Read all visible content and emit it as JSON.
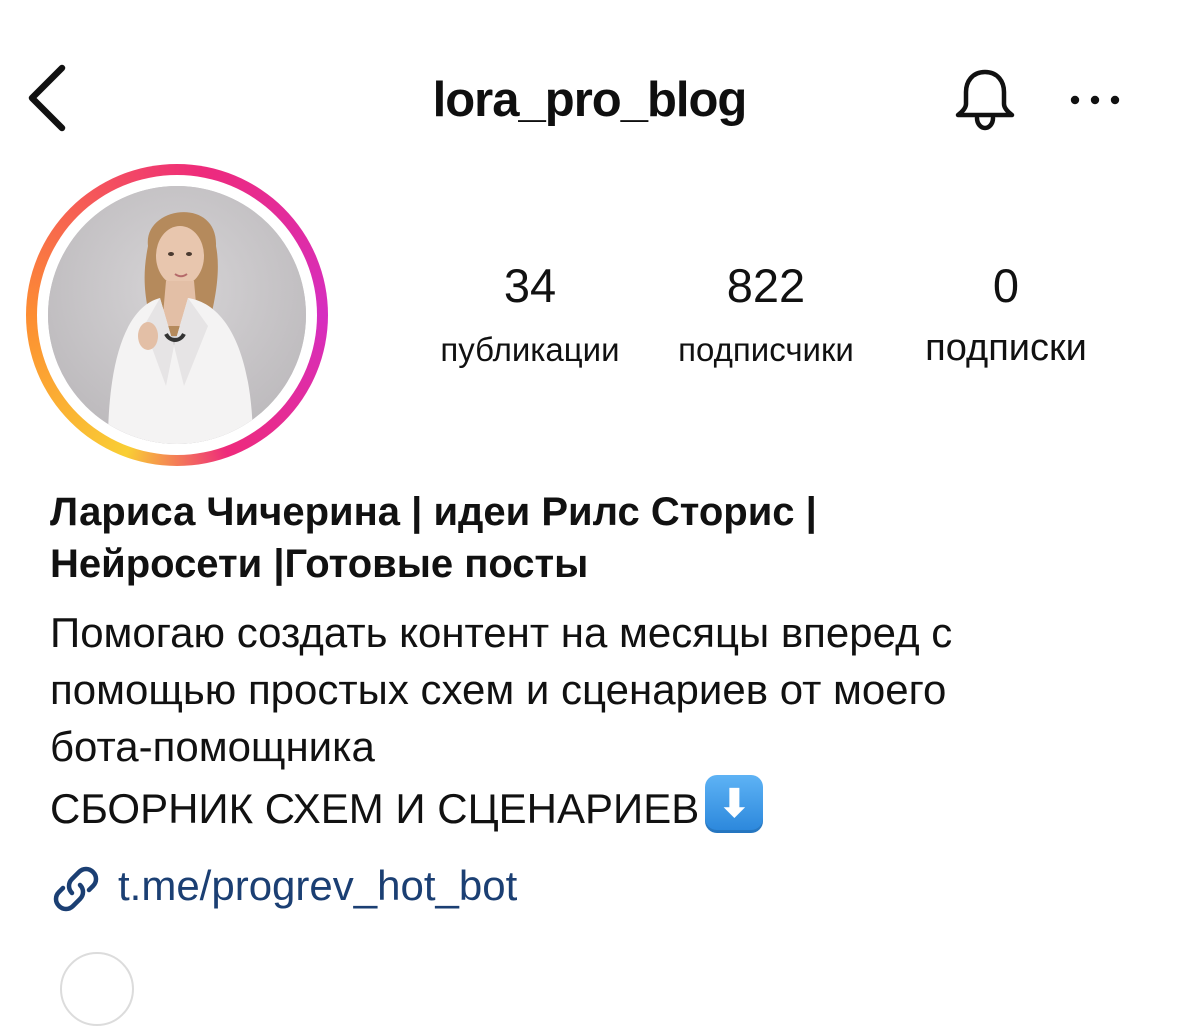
{
  "header": {
    "username": "lora_pro_blog",
    "back_icon": "chevron-left-icon",
    "bell_icon": "bell-icon",
    "more_icon": "more-horizontal-icon"
  },
  "profile": {
    "avatar_alt": "profile photo",
    "ring_colors": [
      "#f9ce34",
      "#fd8d32",
      "#ee2a7b",
      "#d62ec0"
    ]
  },
  "stats": {
    "posts": {
      "value": "34",
      "label": "публикации"
    },
    "followers": {
      "value": "822",
      "label": "подписчики"
    },
    "following": {
      "value": "0",
      "label": "подписки"
    }
  },
  "bio": {
    "name_line1": "Лариса Чичерина | идеи Рилс Сторис |",
    "name_line2": "Нейросети |Готовые посты",
    "lines": [
      "Помогаю создать контент на месяцы вперед с",
      "помощью простых схем и сценариев от моего",
      "бота-помощника",
      "СБОРНИК СХЕМ И СЦЕНАРИЕВ"
    ],
    "emoji": "⬇",
    "link": "t.me/progrev_hot_bot",
    "link_icon": "link-icon"
  },
  "colors": {
    "link": "#1b3f73",
    "text": "#111111",
    "background": "#ffffff"
  }
}
